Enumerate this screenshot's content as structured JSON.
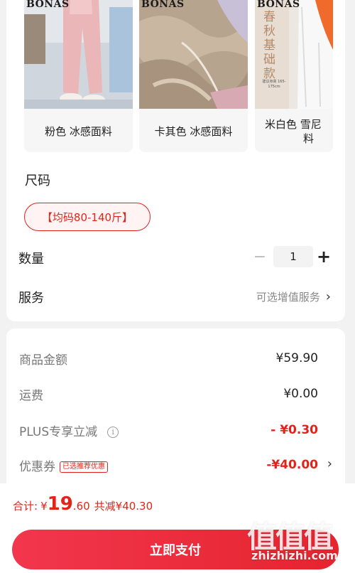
{
  "variants": [
    {
      "caption": "粉色 冰感面料",
      "brand": "BONAS",
      "selected": false
    },
    {
      "caption": "卡其色 冰感面料",
      "brand": "BONAS",
      "selected": false
    },
    {
      "caption": "米白色 雪尼尔 料",
      "caption_line1": "米白色 雪尼",
      "caption_line2": "料",
      "brand": "BONAS",
      "poster_text": "春秋基础款",
      "poster_small": "建议身高 165-175cm",
      "selected": false
    }
  ],
  "size": {
    "label": "尺码",
    "option": "【均码80-140斤】"
  },
  "quantity": {
    "label": "数量",
    "minus": "−",
    "value": "1",
    "plus": "+"
  },
  "service": {
    "label": "服务",
    "value": "可选增值服务",
    "chevron": "›"
  },
  "price_rows": [
    {
      "label": "商品金额",
      "value": "¥59.90",
      "red": false
    },
    {
      "label": "运费",
      "value": "¥0.00",
      "red": false
    },
    {
      "label": "PLUS专享立减",
      "value": "- ¥0.30",
      "red": true,
      "info_icon": "info-icon"
    },
    {
      "label": "优惠券",
      "tag": "已选推荐优惠",
      "value": "-¥40.00",
      "red": true,
      "chevron": "›"
    }
  ],
  "total": {
    "label": "合计:",
    "currency": "¥",
    "integer": "19",
    "decimal": ".60",
    "saved": "共减¥40.30"
  },
  "pay_button": "立即支付",
  "watermark": {
    "big": "值值值",
    "small": "zhizhizhi.com"
  },
  "colors": {
    "accent": "#e2231a",
    "button_start": "#f2364d",
    "button_end": "#e5242e"
  }
}
